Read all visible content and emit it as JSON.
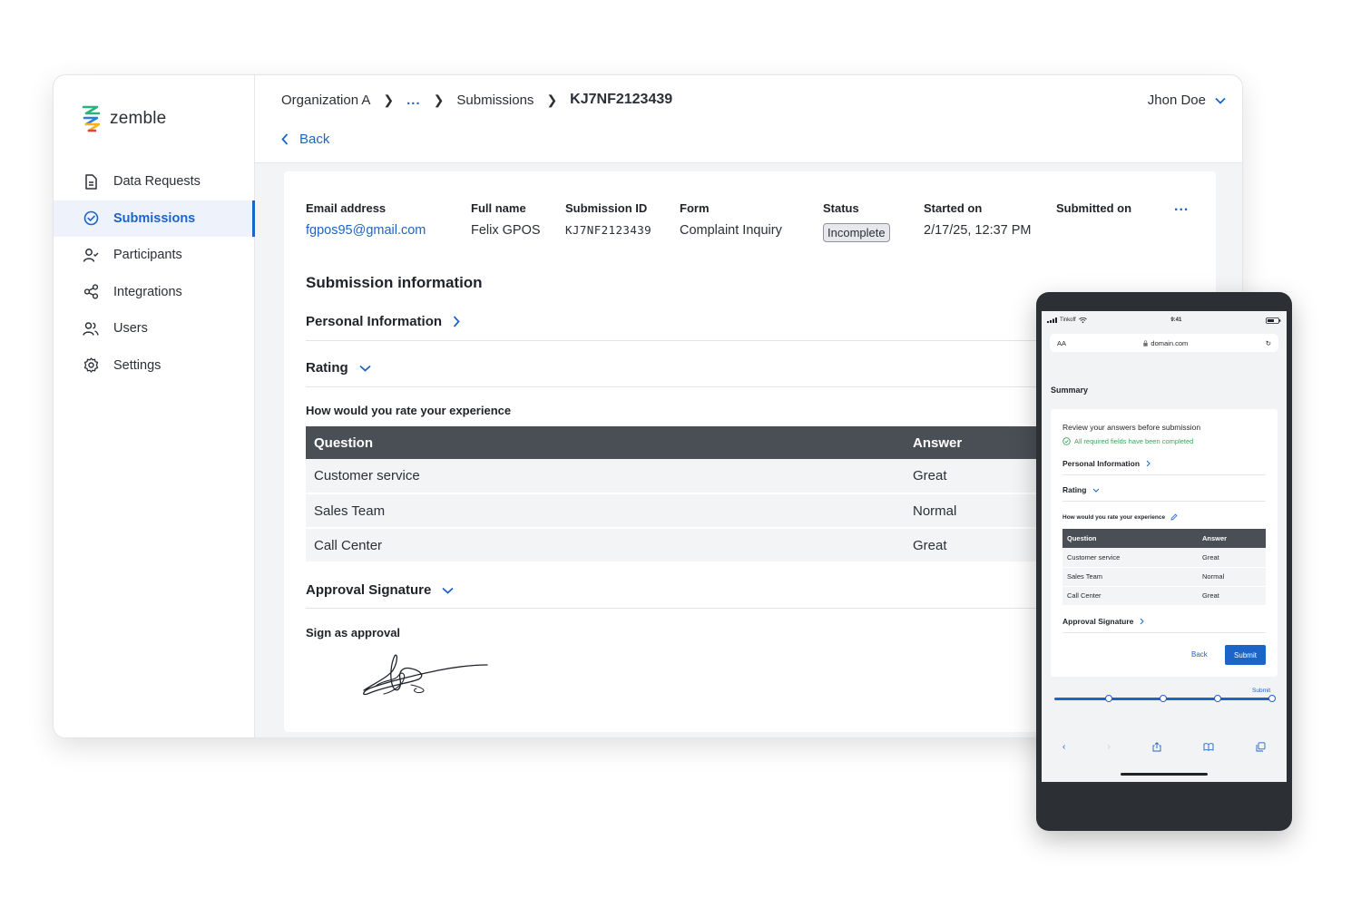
{
  "app": {
    "name": "zemble"
  },
  "sidebar": {
    "items": [
      {
        "label": "Data Requests",
        "icon": "document-icon"
      },
      {
        "label": "Submissions",
        "icon": "check-circle-icon",
        "active": true
      },
      {
        "label": "Participants",
        "icon": "participant-icon"
      },
      {
        "label": "Integrations",
        "icon": "share-nodes-icon"
      },
      {
        "label": "Users",
        "icon": "users-icon"
      },
      {
        "label": "Settings",
        "icon": "gear-icon"
      }
    ]
  },
  "header": {
    "breadcrumbs": [
      "Organization A",
      "...",
      "Submissions",
      "KJ7NF2123439"
    ],
    "user_name": "Jhon Doe",
    "back_label": "Back"
  },
  "details": {
    "email": {
      "label": "Email address",
      "value": "fgpos95@gmail.com"
    },
    "full_name": {
      "label": "Full name",
      "value": "Felix GPOS"
    },
    "submission_id": {
      "label": "Submission ID",
      "value": "KJ7NF2123439"
    },
    "form": {
      "label": "Form",
      "value": "Complaint Inquiry"
    },
    "status": {
      "label": "Status",
      "value": "Incomplete"
    },
    "started_on": {
      "label": "Started on",
      "value": "2/17/25, 12:37 PM"
    },
    "submitted_on": {
      "label": "Submitted on",
      "value": ""
    },
    "more_label": "..."
  },
  "submission": {
    "title": "Submission information",
    "personal_info_label": "Personal Information",
    "rating_label": "Rating",
    "rating_question": "How would you rate your experience",
    "table": {
      "headers": [
        "Question",
        "Answer"
      ],
      "rows": [
        {
          "question": "Customer service",
          "answer": "Great"
        },
        {
          "question": "Sales Team",
          "answer": "Normal"
        },
        {
          "question": "Call Center",
          "answer": "Great"
        }
      ]
    },
    "approval_label": "Approval Signature",
    "sign_label": "Sign as approval"
  },
  "phone": {
    "carrier": "Tinkoff",
    "time": "9:41",
    "text_size": "AA",
    "url": "domain.com",
    "summary_title": "Summary",
    "review_text": "Review your answers before submission",
    "complete_text": "All required fields have been completed",
    "personal_info_label": "Personal Information",
    "rating_label": "Rating",
    "rating_question": "How would you rate your experience",
    "table": {
      "headers": [
        "Question",
        "Answer"
      ],
      "rows": [
        {
          "question": "Customer service",
          "answer": "Great"
        },
        {
          "question": "Sales Team",
          "answer": "Normal"
        },
        {
          "question": "Call Center",
          "answer": "Great"
        }
      ]
    },
    "approval_label": "Approval Signature",
    "back_label": "Back",
    "submit_label": "Submit",
    "progress_label": "Submit",
    "progress_fraction": 1.0,
    "progress_steps": 5
  },
  "colors": {
    "accent": "#1c64c8",
    "table_header": "#4a4f55",
    "success": "#3aa657",
    "phone_frame": "#2c2f33"
  }
}
